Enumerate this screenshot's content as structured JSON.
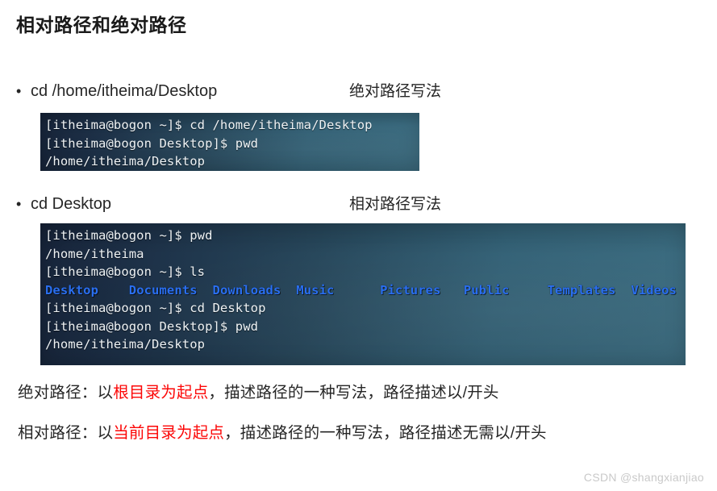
{
  "slide": {
    "title": "相对路径和绝对路径",
    "watermark": "CSDN @shangxianjiao"
  },
  "bullets": [
    {
      "marker": "•",
      "command": "cd /home/itheima/Desktop",
      "note": "绝对路径写法"
    },
    {
      "marker": "•",
      "command": "cd Desktop",
      "note": "相对路径写法"
    }
  ],
  "terminals": [
    {
      "name": "absolute-path-terminal",
      "lines": [
        "[itheima@bogon ~]$ cd /home/itheima/Desktop",
        "[itheima@bogon Desktop]$ pwd",
        "/home/itheima/Desktop"
      ]
    },
    {
      "name": "relative-path-terminal",
      "lines_before_ls": [
        "[itheima@bogon ~]$ pwd",
        "/home/itheima",
        "[itheima@bogon ~]$ ls"
      ],
      "ls_output": [
        "Desktop",
        "Documents",
        "Downloads",
        "Music",
        "Pictures",
        "Public",
        "Templates",
        "Videos"
      ],
      "lines_after_ls": [
        "[itheima@bogon ~]$ cd Desktop",
        "[itheima@bogon Desktop]$ pwd",
        "/home/itheima/Desktop"
      ]
    }
  ],
  "explanations": [
    {
      "label": "绝对路径：以",
      "highlight": "根目录为起点",
      "rest": "，描述路径的一种写法，路径描述以/开头"
    },
    {
      "label": "相对路径：以",
      "highlight": "当前目录为起点",
      "rest": "，描述路径的一种写法，路径描述无需以/开头"
    }
  ],
  "colors": {
    "directory_blue": "#2a6ff0",
    "highlight_red": "#fc0606",
    "terminal_dark": "#17243a",
    "terminal_light": "#3b6c80",
    "text": "#262626"
  }
}
